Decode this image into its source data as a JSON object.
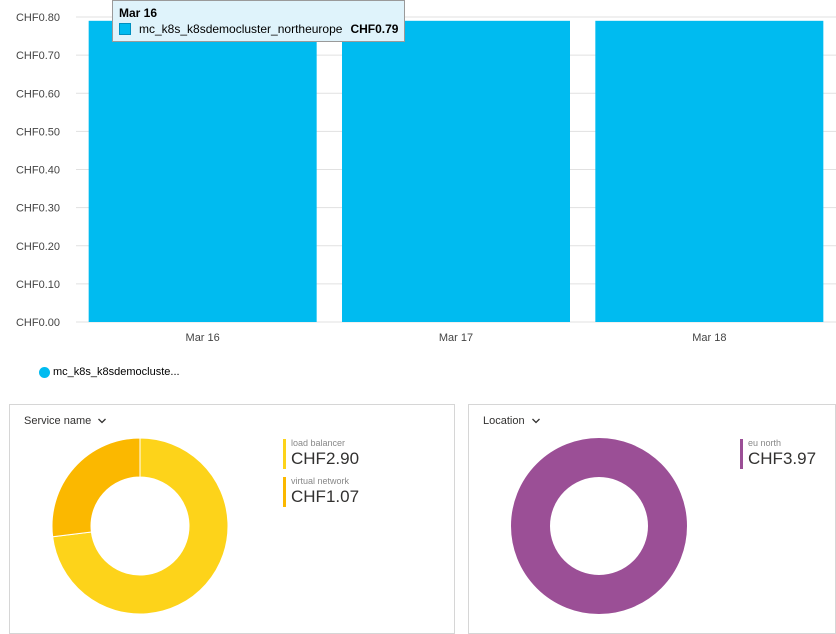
{
  "chart_data": [
    {
      "type": "bar",
      "categories": [
        "Mar 16",
        "Mar 17",
        "Mar 18"
      ],
      "series": [
        {
          "name": "mc_k8s_k8sdemocluster_northeurope",
          "values": [
            0.79,
            0.79,
            0.79
          ],
          "color": "#00bbf0"
        }
      ],
      "ylim": [
        0,
        0.8
      ],
      "yticks": [
        "CHF0.00",
        "CHF0.10",
        "CHF0.20",
        "CHF0.30",
        "CHF0.40",
        "CHF0.50",
        "CHF0.60",
        "CHF0.70",
        "CHF0.80"
      ],
      "grid": true,
      "legend": "bottom-left"
    },
    {
      "type": "pie",
      "variant": "donut",
      "labels": [
        "load balancer",
        "virtual network"
      ],
      "values": [
        2.9,
        1.07
      ],
      "colors": [
        "#fdd31a",
        "#fbb800"
      ]
    },
    {
      "type": "pie",
      "variant": "donut",
      "labels": [
        "eu north"
      ],
      "values": [
        3.97
      ],
      "colors": [
        "#9b4f96"
      ]
    }
  ],
  "tooltip": {
    "date": "Mar 16",
    "series_name": "mc_k8s_k8sdemocluster_northeurope",
    "value": "CHF0.79"
  },
  "legend": {
    "label": "mc_k8s_k8sdemocluste..."
  },
  "service_panel": {
    "title": "Service name",
    "items": [
      {
        "label": "load balancer",
        "value": "CHF2.90",
        "color": "#fdd31a"
      },
      {
        "label": "virtual network",
        "value": "CHF1.07",
        "color": "#fbb800"
      }
    ]
  },
  "location_panel": {
    "title": "Location",
    "items": [
      {
        "label": "eu north",
        "value": "CHF3.97",
        "color": "#9b4f96"
      }
    ]
  }
}
